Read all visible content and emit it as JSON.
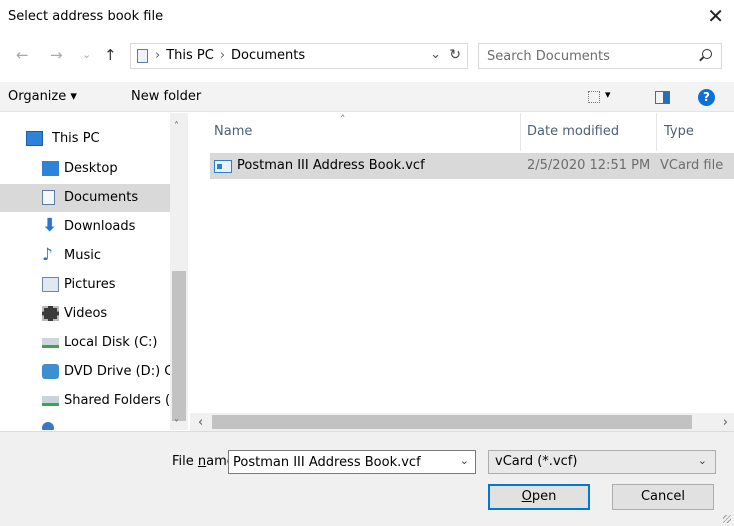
{
  "window": {
    "title": "Select address book file",
    "close_glyph": "✕"
  },
  "address": {
    "back_glyph": "←",
    "forward_glyph": "→",
    "recent_glyph": "⌄",
    "up_glyph": "↑",
    "crumbs": [
      "This PC",
      "Documents"
    ],
    "crumb_sep": "›",
    "dropdown_glyph": "⌄",
    "refresh_glyph": "↻"
  },
  "search": {
    "placeholder": "Search Documents"
  },
  "toolbar": {
    "organize_label": "Organize ▾",
    "new_folder_label": "New folder",
    "view_dropdown": "▾",
    "help_label": "?"
  },
  "nav": {
    "items": [
      {
        "label": "This PC",
        "icon": "monitor-icon"
      },
      {
        "label": "Desktop",
        "icon": "desktop-icon"
      },
      {
        "label": "Documents",
        "icon": "documents-icon",
        "selected": true
      },
      {
        "label": "Downloads",
        "icon": "downloads-icon"
      },
      {
        "label": "Music",
        "icon": "music-icon"
      },
      {
        "label": "Pictures",
        "icon": "pictures-icon"
      },
      {
        "label": "Videos",
        "icon": "videos-icon"
      },
      {
        "label": "Local Disk (C:)",
        "icon": "local-disk-icon"
      },
      {
        "label": "DVD Drive (D:) C",
        "icon": "dvd-drive-icon"
      },
      {
        "label": "Shared Folders (\\",
        "icon": "shared-folders-icon"
      }
    ],
    "scroll_up": "˄",
    "scroll_down": "˅"
  },
  "files": {
    "columns": {
      "name": "Name",
      "date": "Date modified",
      "type": "Type"
    },
    "sort_glyph": "˄",
    "rows": [
      {
        "name": "Postman III Address Book.vcf",
        "date": "2/5/2020 12:51 PM",
        "type": "VCard file"
      }
    ],
    "hscroll_left": "‹",
    "hscroll_right": "›"
  },
  "footer": {
    "file_name_label_pre": "File ",
    "file_name_label_u": "n",
    "file_name_label_post": "ame:",
    "file_name_value": "Postman III Address Book.vcf",
    "filter_value": "vCard (*.vcf)",
    "dropdown_glyph": "⌄",
    "open_u": "O",
    "open_rest": "pen",
    "cancel_label": "Cancel"
  },
  "colors": {
    "selection": "#d9d9d9",
    "accent": "#0078d7",
    "help": "#0e6fd6"
  }
}
